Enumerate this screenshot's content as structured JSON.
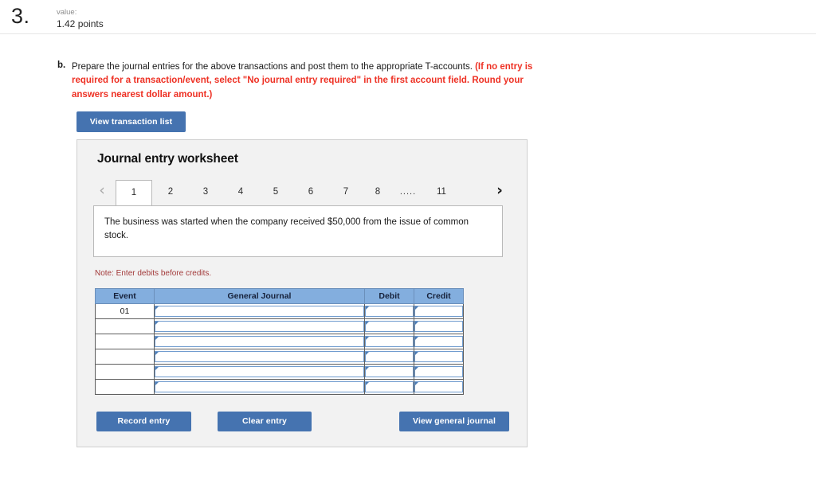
{
  "question": {
    "number": "3.",
    "value_label": "value:",
    "value_amount": "1.42 points",
    "part_letter": "b.",
    "prompt_normal": "Prepare the journal entries for the above transactions and post them to the appropriate T-accounts. ",
    "prompt_emphasis": "(If no entry is required for a transaction/event, select \"No journal entry required\" in the first account field. Round your answers nearest dollar amount.)"
  },
  "toolbar": {
    "view_transaction_list_label": "View transaction list"
  },
  "worksheet": {
    "title": "Journal entry worksheet",
    "tabs": [
      {
        "label": "1",
        "active": true
      },
      {
        "label": "2",
        "active": false
      },
      {
        "label": "3",
        "active": false
      },
      {
        "label": "4",
        "active": false
      },
      {
        "label": "5",
        "active": false
      },
      {
        "label": "6",
        "active": false
      },
      {
        "label": "7",
        "active": false
      },
      {
        "label": "8",
        "active": false
      },
      {
        "label": ".....",
        "active": false,
        "ellipsis": true
      },
      {
        "label": "11",
        "active": false
      }
    ],
    "prev_arrow_glyph": "‹",
    "next_arrow_glyph": "›",
    "transaction_description": "The business was started when the company received $50,000 from the issue of common stock.",
    "note": "Note: Enter debits before credits.",
    "table": {
      "columns": [
        "Event",
        "General Journal",
        "Debit",
        "Credit"
      ],
      "rows": [
        {
          "event": "01",
          "general_journal": "",
          "debit": "",
          "credit": ""
        },
        {
          "event": "",
          "general_journal": "",
          "debit": "",
          "credit": ""
        },
        {
          "event": "",
          "general_journal": "",
          "debit": "",
          "credit": ""
        },
        {
          "event": "",
          "general_journal": "",
          "debit": "",
          "credit": ""
        },
        {
          "event": "",
          "general_journal": "",
          "debit": "",
          "credit": ""
        },
        {
          "event": "",
          "general_journal": "",
          "debit": "",
          "credit": ""
        }
      ]
    },
    "actions": {
      "record_entry_label": "Record entry",
      "clear_entry_label": "Clear entry",
      "view_general_journal_label": "View general journal"
    }
  },
  "colors": {
    "button_blue": "#4573b0",
    "table_header_blue": "#83aede",
    "emphasis_red": "#ee3124",
    "note_red": "#a23a3a",
    "panel_gray": "#f2f2f2"
  }
}
